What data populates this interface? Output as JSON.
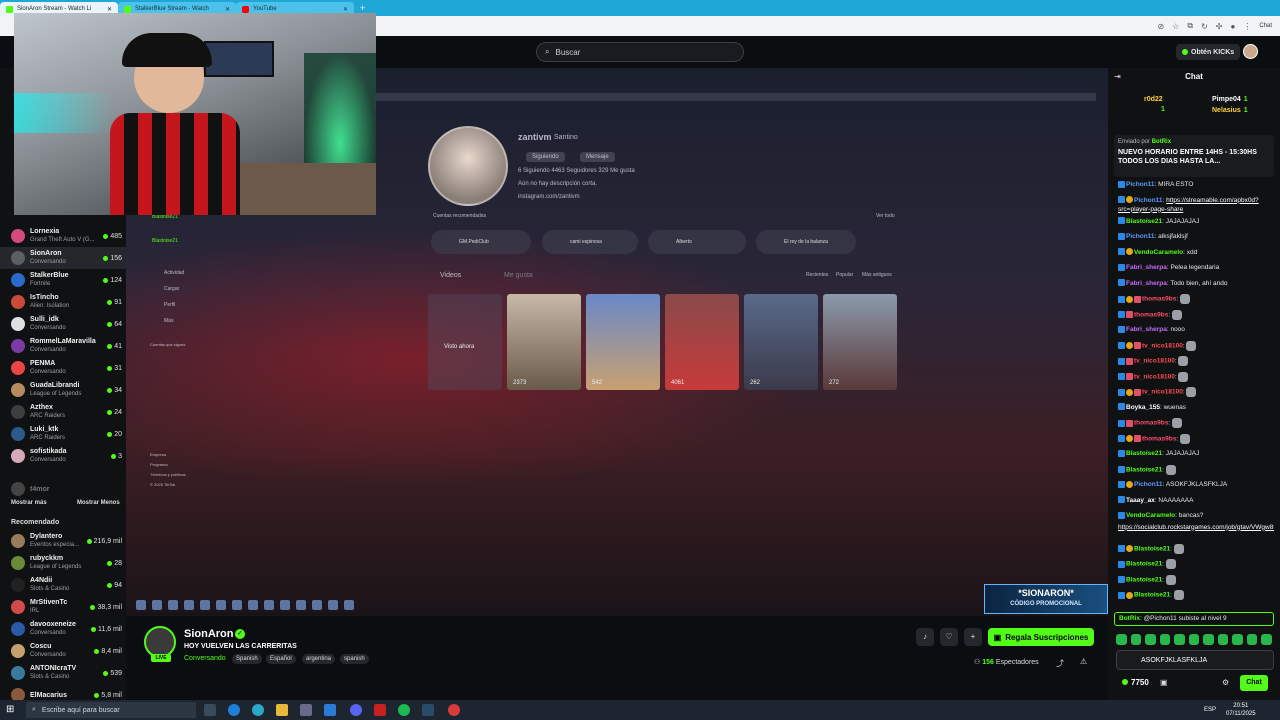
{
  "browser": {
    "tabs": [
      {
        "label": "SionAron Stream - Watch Li",
        "active": true
      },
      {
        "label": "StalkerBlue Stream - Watch",
        "active": false
      },
      {
        "label": "YouTube",
        "active": false
      }
    ],
    "chat_label": "Chat"
  },
  "header": {
    "search_placeholder": "Buscar",
    "kicks_label": "Obtén KICKs"
  },
  "sidebar": {
    "following_top": [
      {
        "name": "Lornexia",
        "category": "Grand Theft Auto V (G...",
        "viewers": "485",
        "color": "#d24b7a"
      },
      {
        "name": "SionAron",
        "category": "Conversando",
        "viewers": "156",
        "color": "#5b5f66",
        "active": true
      },
      {
        "name": "StalkerBlue",
        "category": "Fortnite",
        "viewers": "124",
        "color": "#2a6acb"
      },
      {
        "name": "IsTincho",
        "category": "Alien: Isolation",
        "viewers": "91",
        "color": "#c94c3a"
      },
      {
        "name": "Sulli_idk",
        "category": "Conversando",
        "viewers": "64",
        "color": "#e0e0e0"
      },
      {
        "name": "RommelLaMaravilla",
        "category": "Conversando",
        "viewers": "41",
        "color": "#7b3aa6"
      },
      {
        "name": "PENMA",
        "category": "Conversando",
        "viewers": "31",
        "color": "#e84545"
      },
      {
        "name": "GuadaLibrandi",
        "category": "League of Legends",
        "viewers": "34",
        "color": "#b88b5e"
      },
      {
        "name": "Azthex",
        "category": "ARC Raiders",
        "viewers": "24",
        "color": "#3e3e3e"
      },
      {
        "name": "Luki_ktk",
        "category": "ARC Raiders",
        "viewers": "20",
        "color": "#2b5b8a"
      },
      {
        "name": "sofistikada",
        "category": "Conversando",
        "viewers": "3",
        "color": "#d6a8b8"
      }
    ],
    "offline_partial": "t4mor",
    "show_more": "Mostrar más",
    "show_less": "Mostrar Menos",
    "recommended_heading": "Recomendado",
    "recommended": [
      {
        "name": "Dylantero",
        "category": "Eventos especia...",
        "viewers": "216,9 mil",
        "color": "#9a7a5a"
      },
      {
        "name": "rubyckkm",
        "category": "League of Legends",
        "viewers": "28",
        "color": "#6a8a3a"
      },
      {
        "name": "A4Ndii",
        "category": "Slots & Casino",
        "viewers": "94",
        "color": "#222"
      },
      {
        "name": "MrStivenTc",
        "category": "IRL",
        "viewers": "38,3 mil",
        "color": "#d24b4b"
      },
      {
        "name": "davooxeneize",
        "category": "Conversando",
        "viewers": "11,6 mil",
        "color": "#2a5aa8"
      },
      {
        "name": "Coscu",
        "category": "Conversando",
        "viewers": "8,4 mil",
        "color": "#c8a070"
      },
      {
        "name": "ANTONIcraTV",
        "category": "Slots & Casino",
        "viewers": "539",
        "color": "#3a7a9a"
      },
      {
        "name": "ElMacarius",
        "category": "",
        "viewers": "5,8 mil",
        "color": "#8a5a3a"
      }
    ]
  },
  "video": {
    "profile_name": "zantivm",
    "profile_sub": "Santino",
    "following_btn": "Siguiendo",
    "message_btn": "Mensaje",
    "stats": "6 Siguiendo   4463 Seguidores   329 Me gusta",
    "bio": "Aún no hay descripción corta.",
    "link": "instagram.com/zantivm",
    "suggested": "Cuentas recomendadas",
    "see_all": "Ver todo",
    "pills": [
      "GM.PediClub",
      "cami espinosa",
      "Alberto",
      "El rey de la balanza"
    ],
    "tabs": [
      "Videos",
      "Me gusta"
    ],
    "filters": [
      "Recientes",
      "Popular",
      "Más antiguos"
    ],
    "thumb_counts": [
      "Visto ahora",
      "2373",
      "542",
      "4061",
      "262",
      "272"
    ],
    "side_items": [
      "Blastoise21",
      "Blastoise21",
      "Actividad",
      "Cargar",
      "Perfil",
      "Más"
    ],
    "side_following": "Cuentas que sigues",
    "side_footer": [
      "Empresa",
      "Programa",
      "Términos y políticas",
      "© 2025 TikTok"
    ],
    "promo_title": "*SIONARON*",
    "promo_sub": "CÓDIGO PROMOCIONAL"
  },
  "stream": {
    "streamer": "SionAron",
    "title": "HOY VUELVEN LAS CARRERITAS",
    "category": "Conversando",
    "tags": [
      "Spanish",
      "Español",
      "argentina",
      "spanish"
    ],
    "subs_button": "Regala Suscripciones",
    "viewers_count": "156",
    "viewers_label": "Espectadores"
  },
  "chat": {
    "title": "Chat",
    "leaders": [
      {
        "name": "r0d22",
        "count": "1"
      },
      {
        "name": "Pimpe04",
        "count": "1"
      },
      {
        "name": "Nelasius",
        "count": "1"
      }
    ],
    "pinned_by_prefix": "Enviado por",
    "pinned_by": "BotRix",
    "pinned_msg": "NUEVO HORARIO ENTRE 14HS - 15:30HS TODOS LOS DIAS HASTA LA...",
    "messages": [
      {
        "user": "Pichon11",
        "color": "#5b9cff",
        "text": "MIRA ESTO"
      },
      {
        "user": "Pichon11",
        "color": "#5b9cff",
        "text": "https://streamable.com/apbx0d?src=player-page-share",
        "link": true
      },
      {
        "user": "Blastoise21",
        "color": "#53fc18",
        "text": "JAJAJAJAJ"
      },
      {
        "user": "Pichon11",
        "color": "#5b9cff",
        "text": "alksjfaklsjf"
      },
      {
        "user": "VendoCaramelo",
        "color": "#53fc18",
        "text": "xdd"
      },
      {
        "user": "Fabri_sherpa",
        "color": "#c86bff",
        "text": "Pelea legendaria"
      },
      {
        "user": "Fabri_sherpa",
        "color": "#c86bff",
        "text": "Todo bien, ahí ando"
      },
      {
        "user": "thomas9bs",
        "color": "#ff4d6d",
        "text": ""
      },
      {
        "user": "thomas9bs",
        "color": "#ff4d6d",
        "text": ""
      },
      {
        "user": "Fabri_sherpa",
        "color": "#c86bff",
        "text": "nooo"
      },
      {
        "user": "tv_nico18100",
        "color": "#ff4d4d",
        "text": ""
      },
      {
        "user": "tv_nico18100",
        "color": "#ff4d4d",
        "text": ""
      },
      {
        "user": "tv_nico18100",
        "color": "#ff4d4d",
        "text": ""
      },
      {
        "user": "tv_nico18100",
        "color": "#ff4d4d",
        "text": ""
      },
      {
        "user": "Boyka_155",
        "color": "#ffffff",
        "text": "wuenas"
      },
      {
        "user": "thomas9bs",
        "color": "#ff4d6d",
        "text": ""
      },
      {
        "user": "thomas9bs",
        "color": "#ff4d6d",
        "text": ""
      },
      {
        "user": "Blastoise21",
        "color": "#53fc18",
        "text": "JAJAJAJAJ"
      },
      {
        "user": "Blastoise21",
        "color": "#53fc18",
        "text": ""
      },
      {
        "user": "Pichon11",
        "color": "#5b9cff",
        "text": "ASOKFJKLASFKLJA"
      },
      {
        "user": "Taaay_ax",
        "color": "#ffffff",
        "text": "NAAAAAAA"
      },
      {
        "user": "VendoCaramelo",
        "color": "#53fc18",
        "text": "bancas?"
      },
      {
        "user": "Blastoise21",
        "color": "#53fc18",
        "text": ""
      },
      {
        "user": "Blastoise21",
        "color": "#53fc18",
        "text": ""
      },
      {
        "user": "Blastoise21",
        "color": "#53fc18",
        "text": ""
      },
      {
        "user": "Blastoise21",
        "color": "#53fc18",
        "text": ""
      }
    ],
    "bancas_link": "https://socialclub.rockstargames.com/job/gtav/VWgw8fCSbE6qk5yNTUBdoQ",
    "bot_msg_user": "BotRix",
    "bot_msg": "@Pichon11 subiste al nivel 9",
    "input_text": "ASOKFJKLASFKLJA",
    "points": "7750",
    "send_label": "Chat"
  },
  "taskbar": {
    "search_placeholder": "Escribe aquí para buscar",
    "lang": "ESP",
    "time": "20:51",
    "date": "07/11/2025"
  },
  "colors": {
    "kick_green": "#53fc18",
    "bg": "#0b0e11",
    "panel": "#0f1113"
  }
}
